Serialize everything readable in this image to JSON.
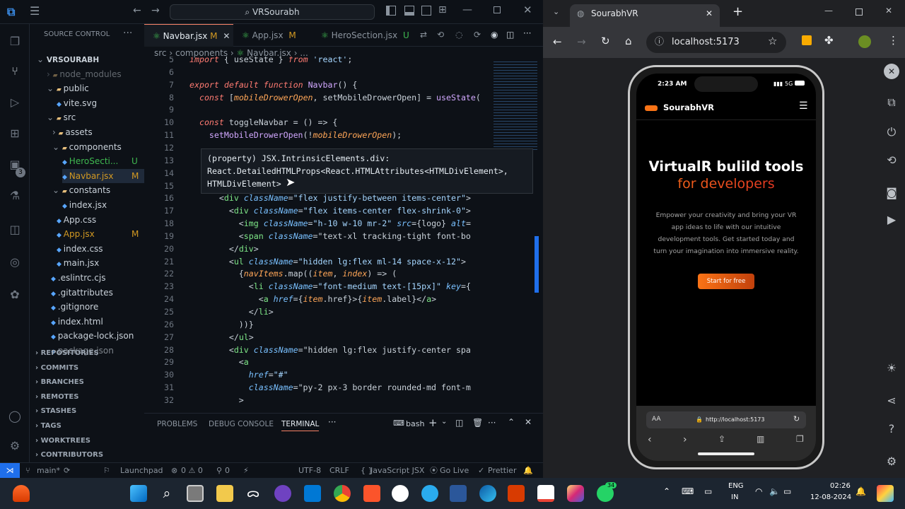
{
  "vscode": {
    "search_text": "VRSourabh",
    "sidebar_title": "SOURCE CONTROL",
    "tree": [
      {
        "label": "VRSOURABH",
        "type": "root"
      },
      {
        "label": "node_modules",
        "type": "folder"
      },
      {
        "label": "public",
        "type": "folder"
      },
      {
        "label": "vite.svg",
        "type": "file"
      },
      {
        "label": "src",
        "type": "folder"
      },
      {
        "label": "assets",
        "type": "folder"
      },
      {
        "label": "components",
        "type": "folder"
      },
      {
        "label": "HeroSecti...",
        "badge": "U",
        "type": "file"
      },
      {
        "label": "Navbar.jsx",
        "badge": "M",
        "type": "file"
      },
      {
        "label": "constants",
        "type": "folder"
      },
      {
        "label": "index.jsx",
        "type": "file"
      },
      {
        "label": "App.css",
        "type": "file"
      },
      {
        "label": "App.jsx",
        "badge": "M",
        "type": "file"
      },
      {
        "label": "index.css",
        "type": "file"
      },
      {
        "label": "main.jsx",
        "type": "file"
      },
      {
        "label": ".eslintrc.cjs",
        "type": "file"
      },
      {
        "label": ".gitattributes",
        "type": "file"
      },
      {
        "label": ".gitignore",
        "type": "file"
      },
      {
        "label": "index.html",
        "type": "file"
      },
      {
        "label": "package-lock.json",
        "type": "file"
      },
      {
        "label": "package.json",
        "type": "file"
      }
    ],
    "sections": [
      "REPOSITORIES",
      "COMMITS",
      "BRANCHES",
      "REMOTES",
      "STASHES",
      "TAGS",
      "WORKTREES",
      "CONTRIBUTORS"
    ],
    "tabs": [
      {
        "label": "Navbar.jsx",
        "badge": "M"
      },
      {
        "label": "App.jsx",
        "badge": "M"
      },
      {
        "label": "HeroSection.jsx",
        "badge": "U"
      }
    ],
    "breadcrumb": [
      "src",
      "components",
      "Navbar.jsx",
      "..."
    ],
    "code": [
      {
        "n": "5",
        "t": "import { useState } from 'react';"
      },
      {
        "n": "6",
        "t": ""
      },
      {
        "n": "7",
        "t": "export default function Navbar() {"
      },
      {
        "n": "8",
        "t": "  const [mobileDrowerOpen, setMobileDrowerOpen] = useState("
      },
      {
        "n": "9",
        "t": ""
      },
      {
        "n": "10",
        "t": "  const toggleNavbar = () => {"
      },
      {
        "n": "11",
        "t": "    setMobileDrowerOpen(!mobileDrowerOpen);"
      },
      {
        "n": "12",
        "t": ""
      },
      {
        "n": "13",
        "t": ""
      },
      {
        "n": "14",
        "t": ""
      },
      {
        "n": "15",
        "t": ""
      },
      {
        "n": "16",
        "t": "      <div className=\"flex justify-between items-center\">"
      },
      {
        "n": "17",
        "t": "        <div className=\"flex items-center flex-shrink-0\">"
      },
      {
        "n": "18",
        "t": "          <img className=\"h-10 w-10 mr-2\" src={logo} alt="
      },
      {
        "n": "19",
        "t": "          <span className=\"text-xl tracking-tight font-bo"
      },
      {
        "n": "20",
        "t": "        </div>"
      },
      {
        "n": "21",
        "t": "        <ul className=\"hidden lg:flex ml-14 space-x-12\">"
      },
      {
        "n": "22",
        "t": "          {navItems.map((item, index) => ("
      },
      {
        "n": "23",
        "t": "            <li className=\"font-medium text-[15px]\" key={"
      },
      {
        "n": "24",
        "t": "              <a href={item.href}>{item.label}</a>"
      },
      {
        "n": "25",
        "t": "            </li>"
      },
      {
        "n": "26",
        "t": "          ))}"
      },
      {
        "n": "27",
        "t": "        </ul>"
      },
      {
        "n": "28",
        "t": "        <div className=\"hidden lg:flex justify-center spa"
      },
      {
        "n": "29",
        "t": "          <a"
      },
      {
        "n": "30",
        "t": "            href=\"#\""
      },
      {
        "n": "31",
        "t": "            className=\"py-2 px-3 border rounded-md font-m"
      },
      {
        "n": "32",
        "t": "          >"
      }
    ],
    "hover": {
      "line1": "(property) JSX.IntrinsicElements.div:",
      "line2": "React.DetailedHTMLProps<React.HTMLAttributes<HTMLDivElement>,",
      "line3": "HTMLDivElement>"
    },
    "panel_tabs": [
      "PROBLEMS",
      "DEBUG CONSOLE",
      "TERMINAL"
    ],
    "terminal_name": "bash",
    "status": {
      "branch": "main*",
      "launchpad": "Launchpad",
      "problems": "0 ⚠ 0",
      "ports": "0",
      "encoding": "UTF-8",
      "eol": "CRLF",
      "language": "JavaScript JSX",
      "golive": "Go Live",
      "prettier": "Prettier"
    }
  },
  "browser": {
    "tab_title": "SourabhVR",
    "url": "localhost:5173",
    "phone": {
      "time": "2:23 AM",
      "signal": "5G",
      "brand": "SourabhVR",
      "headline1": "VirtualR bulild tools",
      "headline2": "for developers",
      "body": "Empower your creativity and bring your VR app ideas to life with our intuitive development tools. Get started today and turn your imagination into immersive reality.",
      "cta": "Start for free",
      "address": "http://localhost:5173",
      "aa": "AA"
    }
  },
  "taskbar": {
    "lang1": "ENG",
    "lang2": "IN",
    "time": "02:26",
    "date": "12-08-2024",
    "badge_count": "34"
  },
  "colors": {
    "accent_orange": "#f97316",
    "accent_red": "#dc2626",
    "vscode_bg": "#0d1117"
  }
}
